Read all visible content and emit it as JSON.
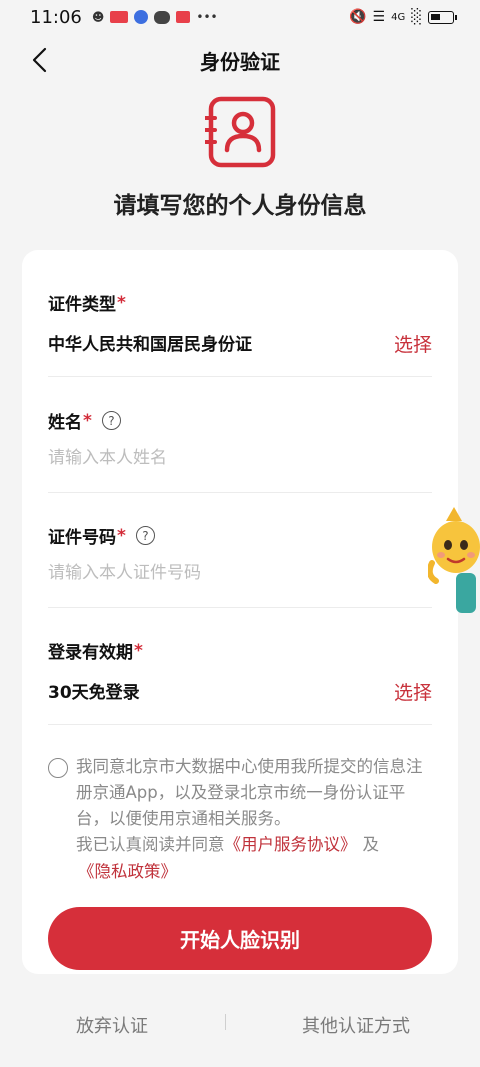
{
  "status_bar": {
    "time": "11:06",
    "network": "4G"
  },
  "nav": {
    "title": "身份验证"
  },
  "hero": {
    "title": "请填写您的个人身份信息"
  },
  "form": {
    "id_type": {
      "label": "证件类型",
      "required": "*",
      "value": "中华人民共和国居民身份证",
      "action": "选择"
    },
    "name": {
      "label": "姓名",
      "required": "*",
      "help": "?",
      "placeholder": "请输入本人姓名",
      "value": ""
    },
    "id_number": {
      "label": "证件号码",
      "required": "*",
      "help": "?",
      "placeholder": "请输入本人证件号码",
      "value": ""
    },
    "login_validity": {
      "label": "登录有效期",
      "required": "*",
      "value": "30天免登录",
      "action": "选择"
    }
  },
  "agreement": {
    "text": "我同意北京市大数据中心使用我所提交的信息注册京通App，以及登录北京市统一身份认证平台，以便使用京通相关服务。",
    "read_prefix": "我已认真阅读并同意",
    "user_agreement": "《用户服务协议》",
    "and": "及",
    "privacy_policy": "《隐私政策》",
    "checked": false
  },
  "primary_button": "开始人脸识别",
  "footer": {
    "left": "放弃认证",
    "right": "其他认证方式"
  },
  "colors": {
    "accent": "#d62f3a",
    "link": "#c0323b",
    "background": "#f4f4f4"
  }
}
